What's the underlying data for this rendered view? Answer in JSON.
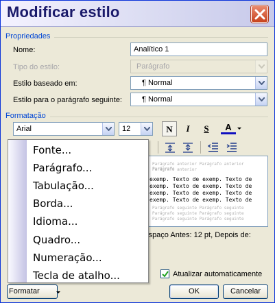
{
  "window": {
    "title": "Modificar estilo"
  },
  "properties": {
    "group_label": "Propriedades",
    "name_label": "Nome:",
    "name_value": "Analítico 1",
    "style_type_label": "Tipo do estilo:",
    "style_type_value": "Parágrafo",
    "based_on_label": "Estilo baseado em:",
    "based_on_value": "¶ Normal",
    "next_style_label": "Estilo para o parágrafo seguinte:",
    "next_style_value": "¶ Normal"
  },
  "formatting": {
    "group_label": "Formatação",
    "font_value": "Arial",
    "size_value": "12",
    "bold_label": "N",
    "italic_label": "I",
    "underline_label": "S",
    "font_color_label": "A"
  },
  "preview": {
    "gray_before": [
      "Parágrafo anterior Parágrafo anterior Parágrafo",
      "Parágrafo anterior"
    ],
    "sample_lines": [
      "exemp. Texto de exemp. Texto de",
      "exemp. Texto de exemp. Texto de",
      "exemp. Texto de exemp. Texto de",
      "exemp. Texto de exemp. Texto de"
    ],
    "gray_after": [
      "Parágrafo seguinte Parágrafo seguinte",
      "Parágrafo seguinte Parágrafo seguinte",
      "Parágrafo seguinte Parágrafo seguinte"
    ]
  },
  "description": "o, Espaço Antes:  12 pt, Depois de:",
  "auto_update": {
    "label": "Atualizar automaticamente",
    "checked": true
  },
  "buttons": {
    "ok": "OK",
    "cancel": "Cancelar",
    "format": "Formatar"
  },
  "format_menu": {
    "items": [
      "Fonte...",
      "Parágrafo...",
      "Tabulação...",
      "Borda...",
      "Idioma...",
      "Quadro...",
      "Numeração...",
      "Tecla de atalho..."
    ]
  }
}
